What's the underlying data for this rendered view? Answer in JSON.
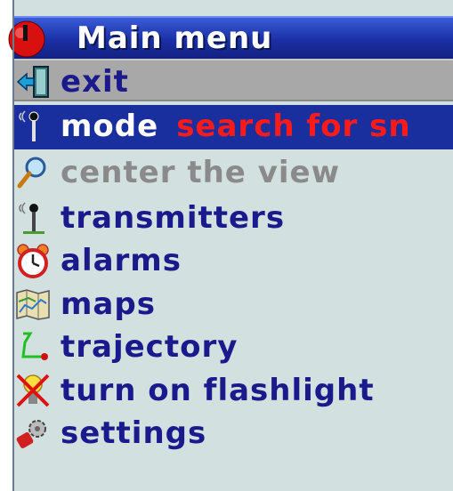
{
  "menu": {
    "title": "Main menu",
    "items": [
      {
        "label": "exit",
        "icon": "exit-icon"
      },
      {
        "label": "mode",
        "value": "search for sn",
        "icon": "antenna-icon"
      },
      {
        "label": "center the view",
        "icon": "magnifier-icon",
        "disabled": true
      },
      {
        "label": "transmitters",
        "icon": "antenna-icon"
      },
      {
        "label": "alarms",
        "icon": "alarm-clock-icon"
      },
      {
        "label": "maps",
        "icon": "map-icon"
      },
      {
        "label": "trajectory",
        "icon": "trajectory-icon"
      },
      {
        "label": "turn on flashlight",
        "icon": "flashlight-icon"
      },
      {
        "label": "settings",
        "icon": "settings-icon"
      }
    ]
  },
  "colors": {
    "title_bar": "#1b2fa4",
    "selected_row": "#1a2f9e",
    "highlight_row": "#a8a8a8",
    "panel_bg": "#d3e0e0",
    "item_text": "#1a1a8c",
    "value_text": "#ff1a1a",
    "disabled_text": "#8a8a8a"
  }
}
